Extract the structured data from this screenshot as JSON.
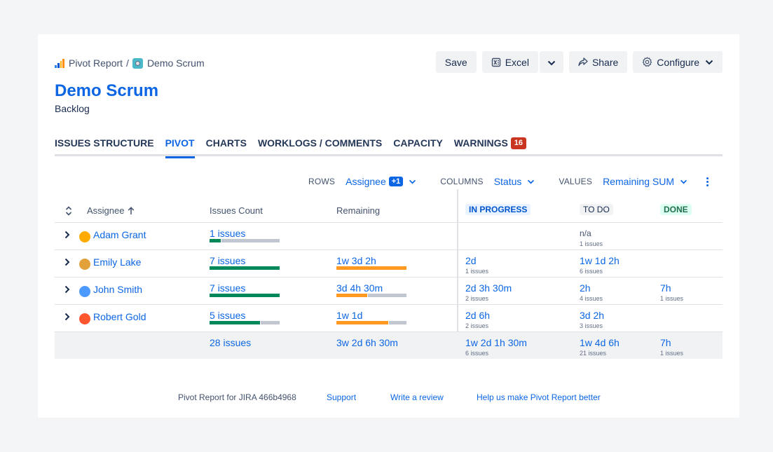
{
  "breadcrumb": {
    "app": "Pivot Report",
    "separator": "/",
    "project": "Demo Scrum"
  },
  "toolbar": {
    "save": "Save",
    "excel": "Excel",
    "share": "Share",
    "configure": "Configure"
  },
  "header": {
    "title": "Demo Scrum",
    "subtitle": "Backlog"
  },
  "tabs": [
    {
      "label": "ISSUES STRUCTURE"
    },
    {
      "label": "PIVOT",
      "active": true
    },
    {
      "label": "CHARTS"
    },
    {
      "label": "WORKLOGS / COMMENTS"
    },
    {
      "label": "CAPACITY"
    },
    {
      "label": "WARNINGS",
      "badge": "16"
    }
  ],
  "controls": {
    "rows_label": "ROWS",
    "rows_value": "Assignee",
    "rows_extra": "+1",
    "columns_label": "COLUMNS",
    "columns_value": "Status",
    "values_label": "VALUES",
    "values_value": "Remaining SUM"
  },
  "table": {
    "headers": {
      "assignee": "Assignee",
      "count": "Issues Count",
      "remaining": "Remaining"
    },
    "statuses": [
      "IN PROGRESS",
      "TO DO",
      "DONE"
    ],
    "rows": [
      {
        "name": "Adam Grant",
        "count": "1 issues",
        "count_fraction": 0.16,
        "remaining": "",
        "remaining_fraction": 0,
        "in_progress": "",
        "in_progress_sub": "",
        "todo": "n/a",
        "todo_sub": "1 issues",
        "done": "",
        "done_sub": ""
      },
      {
        "name": "Emily Lake",
        "count": "7 issues",
        "count_fraction": 1.0,
        "remaining": "1w 3d 2h",
        "remaining_fraction": 1.0,
        "in_progress": "2d",
        "in_progress_sub": "1 issues",
        "todo": "1w 1d 2h",
        "todo_sub": "6 issues",
        "done": "",
        "done_sub": ""
      },
      {
        "name": "John Smith",
        "count": "7 issues",
        "count_fraction": 1.0,
        "remaining": "3d 4h 30m",
        "remaining_fraction": 0.44,
        "in_progress": "2d 3h 30m",
        "in_progress_sub": "2 issues",
        "todo": "2h",
        "todo_sub": "4 issues",
        "done": "7h",
        "done_sub": "1 issues"
      },
      {
        "name": "Robert Gold",
        "count": "5 issues",
        "count_fraction": 0.72,
        "remaining": "1w 1d",
        "remaining_fraction": 0.74,
        "in_progress": "2d 6h",
        "in_progress_sub": "2 issues",
        "todo": "3d 2h",
        "todo_sub": "3 issues",
        "done": "",
        "done_sub": ""
      }
    ],
    "total": {
      "count": "28 issues",
      "remaining": "3w 2d 6h 30m",
      "in_progress": "1w 2d 1h 30m",
      "in_progress_sub": "6 issues",
      "todo": "1w 4d 6h",
      "todo_sub": "21 issues",
      "done": "7h",
      "done_sub": "1 issues"
    }
  },
  "footer": {
    "version": "Pivot Report for JIRA 466b4968",
    "support": "Support",
    "review": "Write a review",
    "help": "Help us make Pivot Report better"
  },
  "colors": {
    "accent": "#0c66e4",
    "count_bar": "#00875a",
    "remaining_bar": "#ff991f",
    "warning_badge": "#ca3521"
  }
}
